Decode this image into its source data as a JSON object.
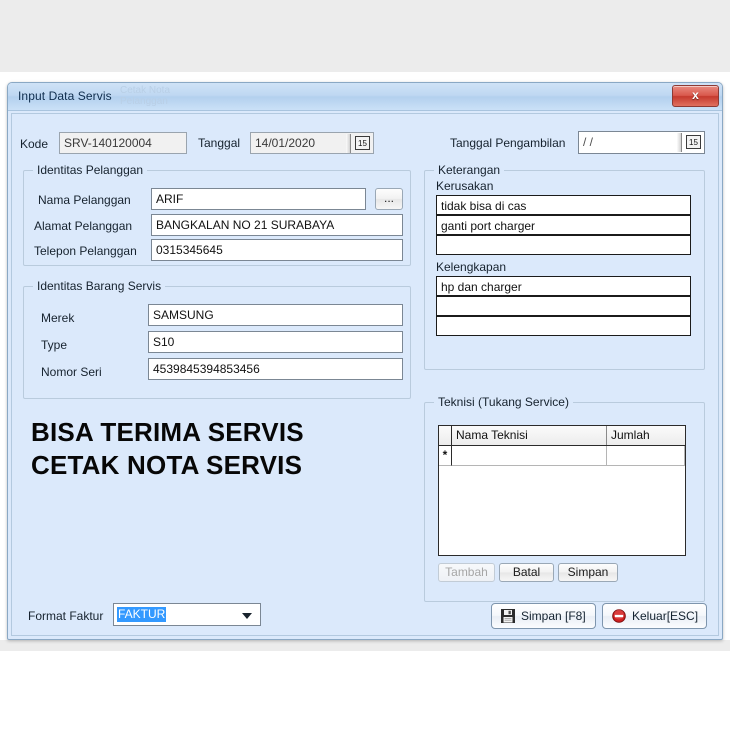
{
  "window": {
    "title": "Input Data Servis",
    "ghost_text_line1": "Cetak Nota",
    "ghost_text_line2": "Pelanggan",
    "close_label": "x"
  },
  "header": {
    "kode_label": "Kode",
    "kode_value": "SRV-140120004",
    "tanggal_label": "Tanggal",
    "tanggal_value": "14/01/2020",
    "tanggal_pengambilan_label": "Tanggal Pengambilan",
    "tanggal_pengambilan_value": "/   /",
    "calendar_icon_glyph": "15"
  },
  "customer_group": {
    "title": "Identitas Pelanggan",
    "fields": [
      {
        "label": "Nama Pelanggan",
        "value": "ARIF"
      },
      {
        "label": "Alamat Pelanggan",
        "value": "BANGKALAN NO 21 SURABAYA"
      },
      {
        "label": "Telepon Pelanggan",
        "value": "0315345645"
      }
    ],
    "browse_label": "..."
  },
  "item_group": {
    "title": "Identitas Barang Servis",
    "fields": [
      {
        "label": "Merek",
        "value": "SAMSUNG"
      },
      {
        "label": "Type",
        "value": "S10"
      },
      {
        "label": "Nomor Seri",
        "value": "4539845394853456"
      }
    ]
  },
  "watermark": {
    "line1": "BISA TERIMA SERVIS",
    "line2": "CETAK NOTA SERVIS"
  },
  "notes_group": {
    "title": "Keterangan",
    "kerusakan_label": "Kerusakan",
    "kerusakan_rows": [
      "tidak bisa di cas",
      "ganti port charger",
      ""
    ],
    "kelengkapan_label": "Kelengkapan",
    "kelengkapan_rows": [
      "hp dan charger",
      "",
      ""
    ]
  },
  "technician_group": {
    "title": "Teknisi (Tukang Service)",
    "columns": [
      "",
      "Nama Teknisi",
      "Jumlah"
    ],
    "rows": [
      {
        "marker": "*",
        "nama_teknisi": "",
        "jumlah": ""
      }
    ],
    "buttons": [
      {
        "label": "Tambah",
        "disabled": true
      },
      {
        "label": "Batal",
        "disabled": false
      },
      {
        "label": "Simpan",
        "disabled": false
      }
    ]
  },
  "footer": {
    "format_faktur_label": "Format Faktur",
    "format_faktur_value": "FAKTUR",
    "save_button_label": "Simpan [F8]",
    "exit_button_label": "Keluar[ESC]"
  },
  "colors": {
    "form_background": "#dbe9fb",
    "titlebar": "#bfd8f2",
    "close_button": "#c5392d",
    "selection_blue": "#3399ff",
    "group_border": "#b9cbdd"
  }
}
